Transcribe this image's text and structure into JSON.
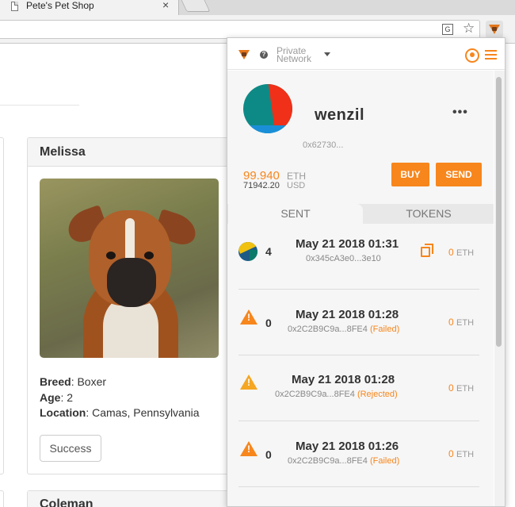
{
  "browser": {
    "tab_title": "Pete's Pet Shop",
    "tab_close": "×",
    "translate_glyph": "G",
    "star_glyph": "☆"
  },
  "page": {
    "pet": {
      "name": "Melissa",
      "breed_label": "Breed",
      "breed": ": Boxer",
      "age_label": "Age",
      "age": ": 2",
      "location_label": "Location",
      "location": ": Camas, Pennsylvania",
      "button": "Success"
    },
    "next_pet_name": "Coleman"
  },
  "metamask": {
    "network": "Private Network",
    "help_glyph": "?",
    "more_glyph": "•••",
    "account_name": "wenzil",
    "address": "0x62730...",
    "eth_balance": "99.940",
    "eth_unit": "ETH",
    "usd_balance": "71942.20",
    "usd_unit": "USD",
    "buy_label": "BUY",
    "send_label": "SEND",
    "tab_sent": "SENT",
    "tab_tokens": "TOKENS",
    "accent": "#f7861c",
    "transactions": [
      {
        "nonce": "4",
        "date": "May 21 2018 01:31",
        "address": "0x345cA3e0...3e10",
        "status": "",
        "value": "0",
        "unit": "ETH",
        "icon": "identicon"
      },
      {
        "nonce": "0",
        "date": "May 21 2018 01:28",
        "address": "0x2C2B9C9a...8FE4",
        "status": " (Failed)",
        "value": "0",
        "unit": "ETH",
        "icon": "warning-icon"
      },
      {
        "nonce": "",
        "date": "May 21 2018 01:28",
        "address": "0x2C2B9C9a...8FE4",
        "status": " (Rejected)",
        "value": "0",
        "unit": "ETH",
        "icon": "warning-icon"
      },
      {
        "nonce": "0",
        "date": "May 21 2018 01:26",
        "address": "0x2C2B9C9a...8FE4",
        "status": " (Failed)",
        "value": "0",
        "unit": "ETH",
        "icon": "warning-icon"
      }
    ]
  }
}
